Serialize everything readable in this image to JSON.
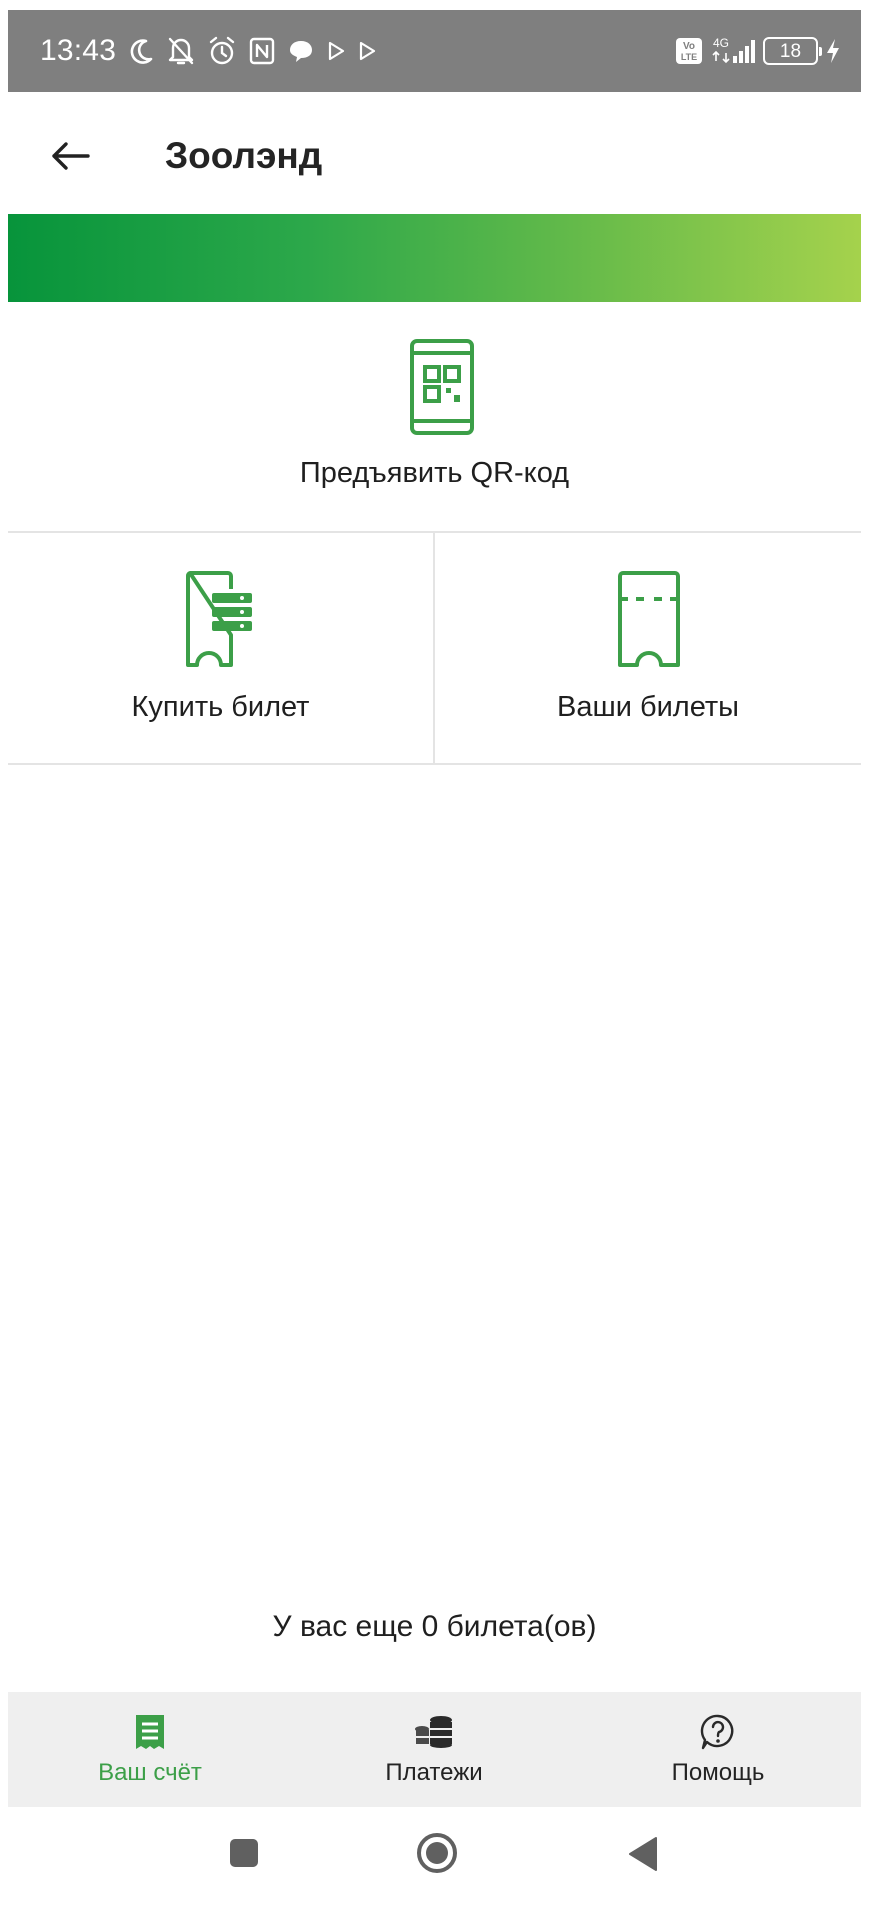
{
  "status_bar": {
    "time": "13:43",
    "network": "4G",
    "volte": "Vo LTE",
    "battery": "18"
  },
  "header": {
    "title": "Зоолэнд"
  },
  "actions": {
    "qr_label": "Предъявить QR-код",
    "buy_label": "Купить билет",
    "my_tickets_label": "Ваши билеты"
  },
  "tickets_remaining": "У вас еще 0 билета(ов)",
  "bottom_nav": {
    "items": [
      {
        "label": "Ваш счёт",
        "icon": "receipt-icon",
        "active": true
      },
      {
        "label": "Платежи",
        "icon": "coins-icon",
        "active": false
      },
      {
        "label": "Помощь",
        "icon": "help-icon",
        "active": false
      }
    ]
  },
  "colors": {
    "accent": "#3c9f48",
    "banner_start": "#07943b",
    "banner_end": "#a5d24c",
    "status_bar": "#7f7f7f",
    "nav_background": "#efefef"
  }
}
